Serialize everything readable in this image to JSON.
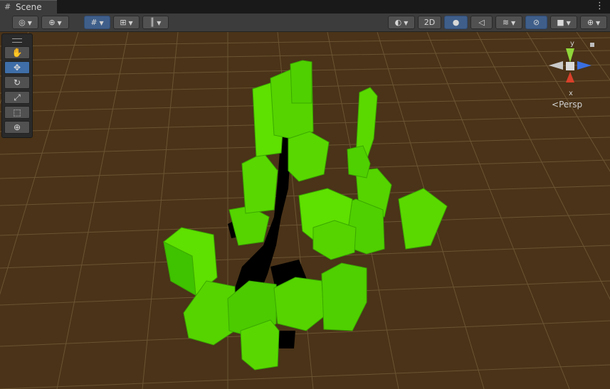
{
  "tab": {
    "label": "Scene",
    "icon": "grid-icon"
  },
  "menu": {
    "icon": "kebab-menu-icon",
    "glyph": "⋮"
  },
  "toolbar": {
    "items": [
      {
        "name": "draw-mode-dropdown",
        "icon": "shaded-icon",
        "glyph": "◎",
        "arrow": "▼"
      },
      {
        "name": "global-local-dropdown",
        "icon": "globe-icon",
        "glyph": "⊕",
        "arrow": "▼"
      },
      {
        "name": "grid-snapping-button",
        "icon": "grid-snap-icon",
        "glyph": "#",
        "arrow": "▼"
      },
      {
        "name": "increment-snap-button",
        "icon": "snap-increment-icon",
        "glyph": "⊞",
        "arrow": "▼"
      },
      {
        "name": "ruler-dropdown",
        "icon": "ruler-icon",
        "glyph": "║",
        "arrow": "▼"
      },
      {
        "name": "shading-mode-dropdown",
        "icon": "sphere-icon",
        "glyph": "◐",
        "arrow": "▼"
      },
      {
        "name": "2d-toggle-button",
        "label": "2D"
      },
      {
        "name": "lighting-toggle-button",
        "icon": "lightbulb-icon",
        "glyph": "●"
      },
      {
        "name": "audio-toggle-button",
        "icon": "speaker-icon",
        "glyph": "◁"
      },
      {
        "name": "effects-dropdown",
        "icon": "effects-icon",
        "glyph": "≋",
        "arrow": "▼"
      },
      {
        "name": "hidden-objects-toggle",
        "icon": "eye-slash-icon",
        "glyph": "⊘"
      },
      {
        "name": "camera-dropdown",
        "icon": "camera-icon",
        "glyph": "■",
        "arrow": "▼"
      },
      {
        "name": "gizmos-dropdown",
        "icon": "gizmo-icon",
        "glyph": "⊕",
        "arrow": "▼"
      }
    ]
  },
  "tools": [
    {
      "name": "hand-tool",
      "icon": "hand-icon",
      "glyph": "✋"
    },
    {
      "name": "move-tool",
      "icon": "move-icon",
      "glyph": "✥"
    },
    {
      "name": "rotate-tool",
      "icon": "rotate-icon",
      "glyph": "↻"
    },
    {
      "name": "scale-tool",
      "icon": "scale-icon",
      "glyph": "⤢"
    },
    {
      "name": "rect-tool",
      "icon": "rect-icon",
      "glyph": "⬚"
    },
    {
      "name": "transform-tool",
      "icon": "transform-icon",
      "glyph": "⊕"
    }
  ],
  "gizmo": {
    "y_label": "y",
    "x_label": "x",
    "projection": "Persp",
    "lock_icon": "lock-icon"
  },
  "colors": {
    "ground": "#4a3318",
    "grid": "#6b5433",
    "building": "#55d400",
    "road": "#000000"
  }
}
